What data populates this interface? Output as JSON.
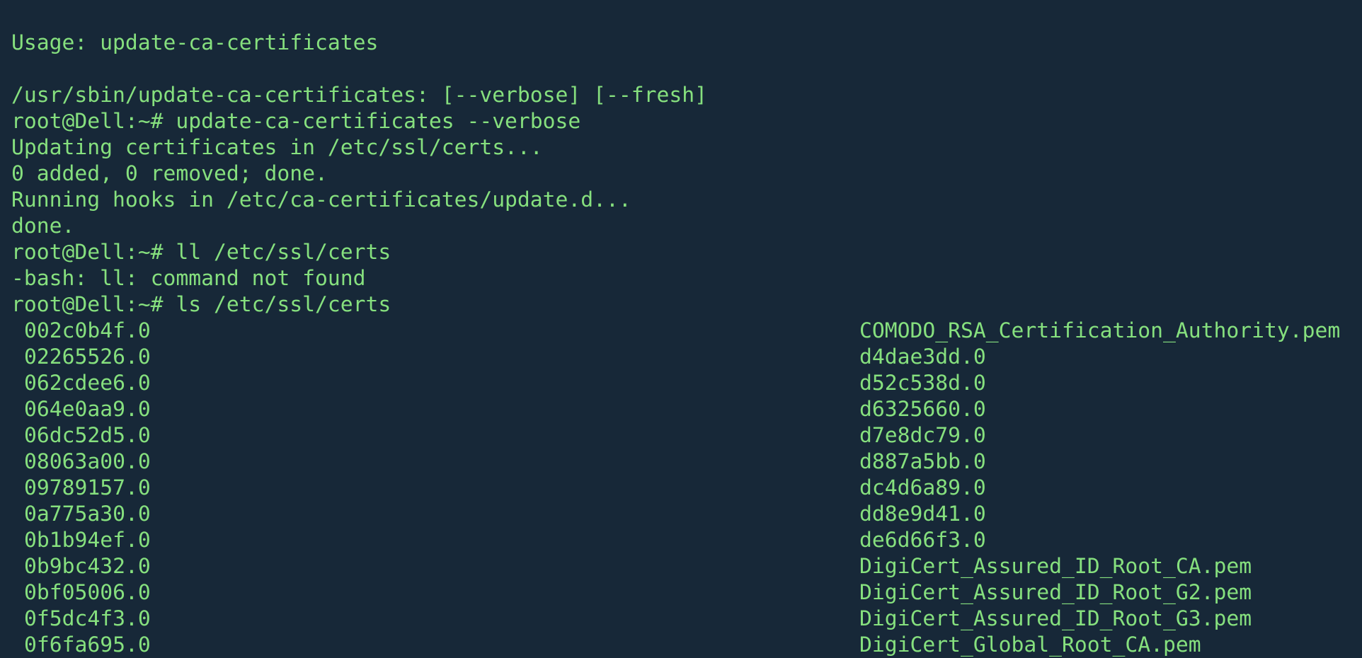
{
  "colors": {
    "background": "#172838",
    "text": "#86e07e"
  },
  "terminal": {
    "partial_top_line": "Usage: update-ca-certificates",
    "lines": [
      "/usr/sbin/update-ca-certificates: [--verbose] [--fresh]",
      "root@Dell:~# update-ca-certificates --verbose",
      "Updating certificates in /etc/ssl/certs...",
      "0 added, 0 removed; done.",
      "Running hooks in /etc/ca-certificates/update.d...",
      "done.",
      "root@Dell:~# ll /etc/ssl/certs",
      "-bash: ll: command not found",
      "root@Dell:~# ls /etc/ssl/certs"
    ],
    "ls_left": [
      "002c0b4f.0",
      "02265526.0",
      "062cdee6.0",
      "064e0aa9.0",
      "06dc52d5.0",
      "08063a00.0",
      "09789157.0",
      "0a775a30.0",
      "0b1b94ef.0",
      "0b9bc432.0",
      "0bf05006.0",
      "0f5dc4f3.0",
      "0f6fa695.0"
    ],
    "ls_right": [
      "COMODO_RSA_Certification_Authority.pem",
      "d4dae3dd.0",
      "d52c538d.0",
      "d6325660.0",
      "d7e8dc79.0",
      "d887a5bb.0",
      "dc4d6a89.0",
      "dd8e9d41.0",
      "de6d66f3.0",
      "DigiCert_Assured_ID_Root_CA.pem",
      "DigiCert_Assured_ID_Root_G2.pem",
      "DigiCert_Assured_ID_Root_G3.pem",
      "DigiCert_Global_Root_CA.pem"
    ]
  }
}
